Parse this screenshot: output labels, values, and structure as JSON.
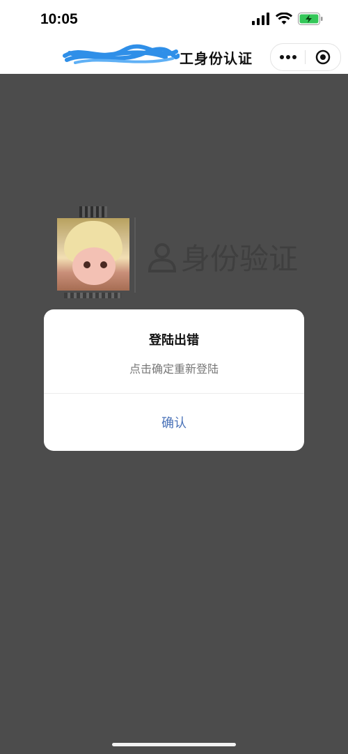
{
  "status_bar": {
    "time": "10:05"
  },
  "nav": {
    "title_visible": "工身份认证",
    "menu_icon": "more-dots-icon",
    "close_icon": "target-circle-icon"
  },
  "page": {
    "section_title": "身份验证",
    "user_icon": "person-outline-icon"
  },
  "dialog": {
    "title": "登陆出错",
    "message": "点击确定重新登陆",
    "confirm_label": "确认"
  },
  "colors": {
    "overlay": "#4c4c4c",
    "dialog_bg": "#ffffff",
    "accent_link": "#4a72b8",
    "battery_green": "#34c759"
  }
}
